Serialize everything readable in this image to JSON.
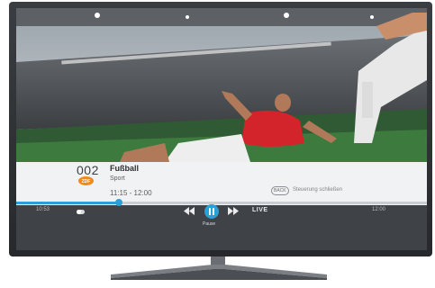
{
  "program": {
    "channel_number": "002",
    "channel_logo": "ZDF",
    "title": "Fußball",
    "genre": "Sport",
    "time_range": "11:15 - 12:00"
  },
  "hint": {
    "back_key": "BACK",
    "text": "Steuerung schließen"
  },
  "timeline": {
    "start_time": "10:53",
    "end_time": "12:00",
    "progress_fraction": 0.25
  },
  "controls": {
    "pause_label": "Pause",
    "live_label": "LIVE"
  },
  "colors": {
    "accent": "#2aa0d9",
    "zdf_orange": "#f08a1c",
    "control_bar": "#3f4246",
    "info_bar": "#f1f2f3"
  },
  "icons": {
    "rewind": "rewind-icon",
    "pause": "pause-icon",
    "forward": "fast-forward-icon",
    "toggle": "toggle-icon",
    "channel_logo": "zdf-logo-icon"
  }
}
